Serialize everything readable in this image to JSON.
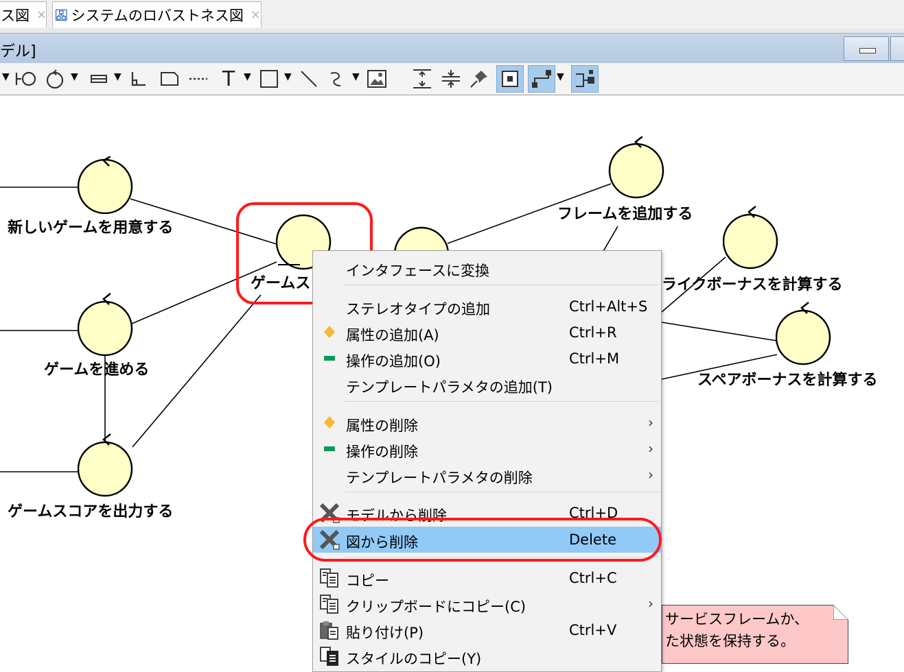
{
  "tabs": [
    {
      "label": "ス図",
      "close": "×"
    },
    {
      "label": "システムのロバストネス図",
      "close": "×",
      "icon": "diagram-icon"
    }
  ],
  "window": {
    "title": "デル]"
  },
  "toolbar": {
    "text_tool": "T",
    "icons": [
      "boundary-icon",
      "control-icon",
      "entity-icon",
      "line-icon",
      "note-icon",
      "dashed-line-icon",
      "text-icon",
      "rectangle-icon",
      "line-tool-icon",
      "freehand-icon",
      "image-icon",
      "align-vertical-icon",
      "align-middle-icon",
      "pin-icon",
      "snap-icon",
      "route-icon",
      "layout-icon"
    ]
  },
  "diagram": {
    "controls": [
      {
        "label": "新しいゲームを用意する"
      },
      {
        "label": "ゲームス"
      },
      {
        "label": "フレームを追加する"
      },
      {
        "label": "ライクボーナスを計算する"
      },
      {
        "label": "ゲームを進める"
      },
      {
        "label": "スペアボーナスを計算する"
      },
      {
        "label": "ゲームスコアを出力する"
      }
    ],
    "note_text": "サービスフレームか、\nた状態を保持する。",
    "colors": {
      "control_fill": "#ffffc8",
      "note_fill": "#ffc8c8",
      "highlight": "#ff1a1a"
    }
  },
  "context_menu": {
    "items": [
      {
        "label": "インタフェースに変換",
        "shortcut": "",
        "icon": ""
      },
      {
        "label": "ステレオタイプの追加",
        "shortcut": "Ctrl+Alt+S",
        "icon": ""
      },
      {
        "label": "属性の追加(A)",
        "shortcut": "Ctrl+R",
        "icon": "attribute-icon"
      },
      {
        "label": "操作の追加(O)",
        "shortcut": "Ctrl+M",
        "icon": "operation-icon"
      },
      {
        "label": "テンプレートパラメタの追加(T)",
        "shortcut": "",
        "icon": ""
      },
      {
        "label": "属性の削除",
        "shortcut": "",
        "icon": "attribute-icon",
        "submenu": "›"
      },
      {
        "label": "操作の削除",
        "shortcut": "",
        "icon": "operation-icon",
        "submenu": "›"
      },
      {
        "label": "テンプレートパラメタの削除",
        "shortcut": "",
        "icon": "",
        "submenu": "›"
      },
      {
        "label": "モデルから削除",
        "shortcut": "Ctrl+D",
        "icon": "delete-model-icon"
      },
      {
        "label": "図から削除",
        "shortcut": "Delete",
        "icon": "delete-diagram-icon",
        "highlighted": true
      },
      {
        "label": "コピー",
        "shortcut": "Ctrl+C",
        "icon": "copy-icon"
      },
      {
        "label": "クリップボードにコピー(C)",
        "shortcut": "",
        "icon": "copy-clipboard-icon",
        "submenu": "›"
      },
      {
        "label": "貼り付け(P)",
        "shortcut": "Ctrl+V",
        "icon": "paste-icon"
      },
      {
        "label": "スタイルのコピー(Y)",
        "shortcut": "",
        "icon": "copy-style-icon"
      }
    ]
  }
}
